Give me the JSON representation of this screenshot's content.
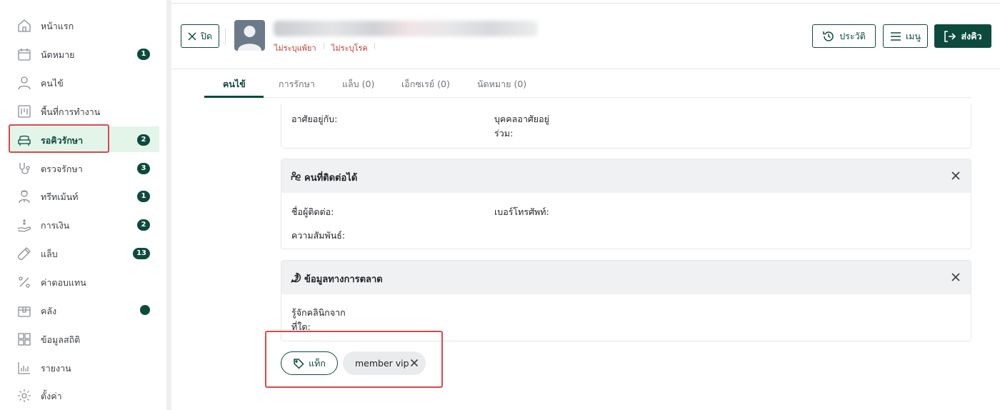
{
  "sidebar": {
    "items": [
      {
        "label": "หน้าแรก",
        "icon": "home-icon",
        "badge": ""
      },
      {
        "label": "นัดหมาย",
        "icon": "calendar-icon",
        "badge": "1"
      },
      {
        "label": "คนไข้",
        "icon": "user-icon",
        "badge": ""
      },
      {
        "label": "พื้นที่การทำงาน",
        "icon": "workspace-icon",
        "badge": ""
      },
      {
        "label": "รอคิวรักษา",
        "icon": "sofa-icon",
        "badge": "2"
      },
      {
        "label": "ตรวจรักษา",
        "icon": "stethoscope-icon",
        "badge": "3"
      },
      {
        "label": "ทรีทเม้นท์",
        "icon": "doctor-icon",
        "badge": "1"
      },
      {
        "label": "การเงิน",
        "icon": "money-hand-icon",
        "badge": "2"
      },
      {
        "label": "แล็บ",
        "icon": "test-tube-icon",
        "badge": "13"
      },
      {
        "label": "ค่าตอบแทน",
        "icon": "percent-icon",
        "badge": ""
      },
      {
        "label": "คลัง",
        "icon": "box-icon",
        "badge": ""
      },
      {
        "label": "ข้อมูลสถิติ",
        "icon": "grid-icon",
        "badge": ""
      },
      {
        "label": "รายงาน",
        "icon": "bar-chart-icon",
        "badge": ""
      },
      {
        "label": "ตั้งค่า",
        "icon": "gear-icon",
        "badge": ""
      }
    ],
    "active_index": 4
  },
  "header": {
    "close_label": "ปิด",
    "allergy_label": "ไม่ระบุแพ้ยา",
    "disease_label": "ไม่ระบุโรค",
    "history_label": "ประวัติ",
    "menu_label": "เมนู",
    "send_queue_label": "ส่งคิว"
  },
  "tabs": [
    {
      "label": "คนไข้"
    },
    {
      "label": "การรักษา"
    },
    {
      "label": "แล็บ (0)"
    },
    {
      "label": "เอ็กซเรย์ (0)"
    },
    {
      "label": "นัดหมาย (0)"
    }
  ],
  "residence_card": {
    "lives_with_label": "อาศัยอยู่กับ:",
    "cohabitant_label_1": "บุคคลอาศัยอยู่",
    "cohabitant_label_2": "ร่วม:"
  },
  "contact_card": {
    "title": "คนที่ติดต่อได้",
    "contact_name_label": "ชื่อผู้ติดต่อ:",
    "phone_label": "เบอร์โทรศัพท์:",
    "relationship_label": "ความสัมพันธ์:"
  },
  "marketing_card": {
    "title": "ข้อมูลทางการตลาด",
    "source_label_1": "รู้จักคลินิกจาก",
    "source_label_2": "ที่ใด:"
  },
  "tags": {
    "add_label": "แท็ก",
    "chips": [
      {
        "label": "member vip"
      }
    ]
  },
  "colors": {
    "brand": "#0d4a3e",
    "active_bg": "#e3f5e9",
    "highlight": "#d9484a",
    "warning_text": "#c0392b"
  }
}
